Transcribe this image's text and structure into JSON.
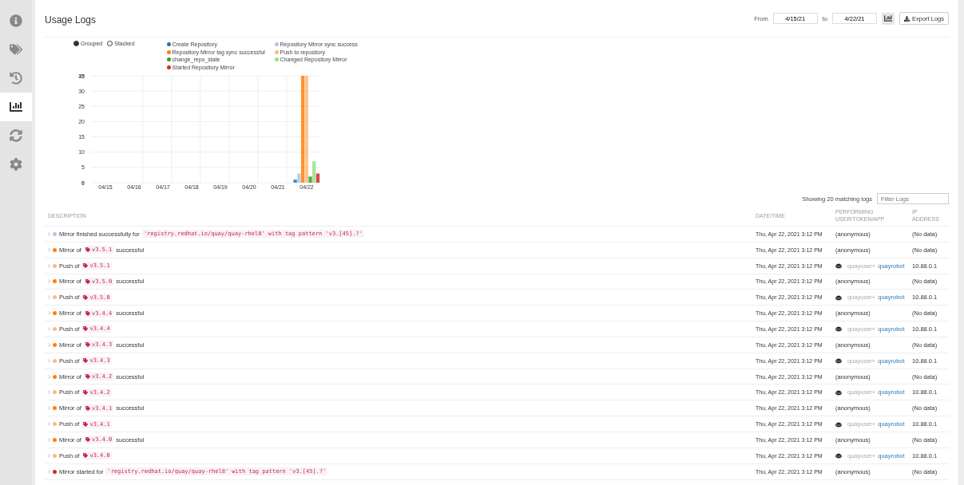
{
  "sidebar": {
    "items": [
      {
        "selected": false
      },
      {
        "selected": false
      },
      {
        "selected": false
      },
      {
        "selected": true
      },
      {
        "selected": false
      },
      {
        "selected": false
      }
    ]
  },
  "page": {
    "title": "Usage Logs"
  },
  "toolbar": {
    "from_label": "From",
    "from_value": "4/15/21",
    "to_label": "to",
    "to_value": "4/22/21",
    "chart_toggle": {
      "selected": true
    },
    "export_button": "Export Logs"
  },
  "chart_mode": [
    {
      "label": "Grouped",
      "selected": true
    },
    {
      "label": "Stacked",
      "selected": false
    }
  ],
  "chart_data": {
    "type": "bar",
    "grid": true,
    "legend": "top",
    "categories": [
      "04/15",
      "04/16",
      "04/17",
      "04/18",
      "04/19",
      "04/20",
      "04/21",
      "04/22"
    ],
    "ylim": [
      0,
      35
    ],
    "yticks": [
      0,
      5,
      10,
      15,
      20,
      25,
      30,
      35
    ],
    "series": [
      {
        "name": "Create Repository",
        "color": "#1f77b4",
        "values": [
          0,
          0,
          0,
          0,
          0,
          0,
          0,
          1
        ]
      },
      {
        "name": "Repository Mirror sync success",
        "color": "#aec7e8",
        "values": [
          0,
          0,
          0,
          0,
          0,
          0,
          0,
          3
        ]
      },
      {
        "name": "Repository Mirror tag sync successful",
        "color": "#ff7f0e",
        "values": [
          0,
          0,
          0,
          0,
          0,
          0,
          0,
          35
        ]
      },
      {
        "name": "Push to repository",
        "color": "#ffbb78",
        "values": [
          0,
          0,
          0,
          0,
          0,
          0,
          0,
          35
        ]
      },
      {
        "name": "change_repo_state",
        "color": "#2ca02c",
        "values": [
          0,
          0,
          0,
          0,
          0,
          0,
          0,
          2
        ]
      },
      {
        "name": "Changed Repository Mirror",
        "color": "#98df8a",
        "values": [
          0,
          0,
          0,
          0,
          0,
          0,
          0,
          7
        ]
      },
      {
        "name": "Started Repository Mirror",
        "color": "#d62728",
        "values": [
          0,
          0,
          0,
          0,
          0,
          0,
          0,
          3
        ]
      }
    ]
  },
  "logs": {
    "count_text": "Showing 20 matching logs",
    "filter": {
      "placeholder": "Filter Logs"
    },
    "columns": [
      "DESCRIPTION",
      "DATE/TIME",
      "PERFORMING USER/TOKEN/APP",
      "IP ADDRESS"
    ],
    "rows": [
      {
        "color": "#aec7e8",
        "kind": "pattern",
        "text": "Mirror finished successfully for",
        "value": "'registry.redhat.io/quay/quay-rhel8' with tag pattern 'v3.[45].?'",
        "date": "Thu, Apr 22, 2021 3:12 PM",
        "performer": {
          "kind": "anonymous",
          "text": "(anonymous)"
        },
        "ip": "(No data)"
      },
      {
        "color": "#ff7f0e",
        "kind": "tag",
        "text": "Mirror of",
        "value": "v3.5.1",
        "suffix": "successful",
        "date": "Thu, Apr 22, 2021 3:12 PM",
        "performer": {
          "kind": "anonymous",
          "text": "(anonymous)"
        },
        "ip": "(No data)"
      },
      {
        "color": "#ffbb78",
        "kind": "tag",
        "text": "Push of",
        "value": "v3.5.1",
        "date": "Thu, Apr 22, 2021 3:12 PM",
        "performer": {
          "kind": "robot",
          "owner": "quayuser+",
          "robot": "quayrobot"
        },
        "ip": "10.88.0.1"
      },
      {
        "color": "#ff7f0e",
        "kind": "tag",
        "text": "Mirror of",
        "value": "v3.5.0",
        "suffix": "successful",
        "date": "Thu, Apr 22, 2021 3:12 PM",
        "performer": {
          "kind": "anonymous",
          "text": "(anonymous)"
        },
        "ip": "(No data)"
      },
      {
        "color": "#ffbb78",
        "kind": "tag",
        "text": "Push of",
        "value": "v3.5.0",
        "date": "Thu, Apr 22, 2021 3:12 PM",
        "performer": {
          "kind": "robot",
          "owner": "quayuser+",
          "robot": "quayrobot"
        },
        "ip": "10.88.0.1"
      },
      {
        "color": "#ff7f0e",
        "kind": "tag",
        "text": "Mirror of",
        "value": "v3.4.4",
        "suffix": "successful",
        "date": "Thu, Apr 22, 2021 3:12 PM",
        "performer": {
          "kind": "anonymous",
          "text": "(anonymous)"
        },
        "ip": "(No data)"
      },
      {
        "color": "#ffbb78",
        "kind": "tag",
        "text": "Push of",
        "value": "v3.4.4",
        "date": "Thu, Apr 22, 2021 3:12 PM",
        "performer": {
          "kind": "robot",
          "owner": "quayuser+",
          "robot": "quayrobot"
        },
        "ip": "10.88.0.1"
      },
      {
        "color": "#ff7f0e",
        "kind": "tag",
        "text": "Mirror of",
        "value": "v3.4.3",
        "suffix": "successful",
        "date": "Thu, Apr 22, 2021 3:12 PM",
        "performer": {
          "kind": "anonymous",
          "text": "(anonymous)"
        },
        "ip": "(No data)"
      },
      {
        "color": "#ffbb78",
        "kind": "tag",
        "text": "Push of",
        "value": "v3.4.3",
        "date": "Thu, Apr 22, 2021 3:12 PM",
        "performer": {
          "kind": "robot",
          "owner": "quayuser+",
          "robot": "quayrobot"
        },
        "ip": "10.88.0.1"
      },
      {
        "color": "#ff7f0e",
        "kind": "tag",
        "text": "Mirror of",
        "value": "v3.4.2",
        "suffix": "successful",
        "date": "Thu, Apr 22, 2021 3:12 PM",
        "performer": {
          "kind": "anonymous",
          "text": "(anonymous)"
        },
        "ip": "(No data)"
      },
      {
        "color": "#ffbb78",
        "kind": "tag",
        "text": "Push of",
        "value": "v3.4.2",
        "date": "Thu, Apr 22, 2021 3:12 PM",
        "performer": {
          "kind": "robot",
          "owner": "quayuser+",
          "robot": "quayrobot"
        },
        "ip": "10.88.0.1"
      },
      {
        "color": "#ff7f0e",
        "kind": "tag",
        "text": "Mirror of",
        "value": "v3.4.1",
        "suffix": "successful",
        "date": "Thu, Apr 22, 2021 3:12 PM",
        "performer": {
          "kind": "anonymous",
          "text": "(anonymous)"
        },
        "ip": "(No data)"
      },
      {
        "color": "#ffbb78",
        "kind": "tag",
        "text": "Push of",
        "value": "v3.4.1",
        "date": "Thu, Apr 22, 2021 3:12 PM",
        "performer": {
          "kind": "robot",
          "owner": "quayuser+",
          "robot": "quayrobot"
        },
        "ip": "10.88.0.1"
      },
      {
        "color": "#ff7f0e",
        "kind": "tag",
        "text": "Mirror of",
        "value": "v3.4.0",
        "suffix": "successful",
        "date": "Thu, Apr 22, 2021 3:12 PM",
        "performer": {
          "kind": "anonymous",
          "text": "(anonymous)"
        },
        "ip": "(No data)"
      },
      {
        "color": "#ffbb78",
        "kind": "tag",
        "text": "Push of",
        "value": "v3.4.0",
        "date": "Thu, Apr 22, 2021 3:12 PM",
        "performer": {
          "kind": "robot",
          "owner": "quayuser+",
          "robot": "quayrobot"
        },
        "ip": "10.88.0.1"
      },
      {
        "color": "#d62728",
        "kind": "pattern",
        "text": "Mirror started for",
        "value": "'registry.redhat.io/quay/quay-rhel8' with tag pattern 'v3.[45].?'",
        "date": "Thu, Apr 22, 2021 3:12 PM",
        "performer": {
          "kind": "anonymous",
          "text": "(anonymous)"
        },
        "ip": "(No data)"
      }
    ]
  }
}
